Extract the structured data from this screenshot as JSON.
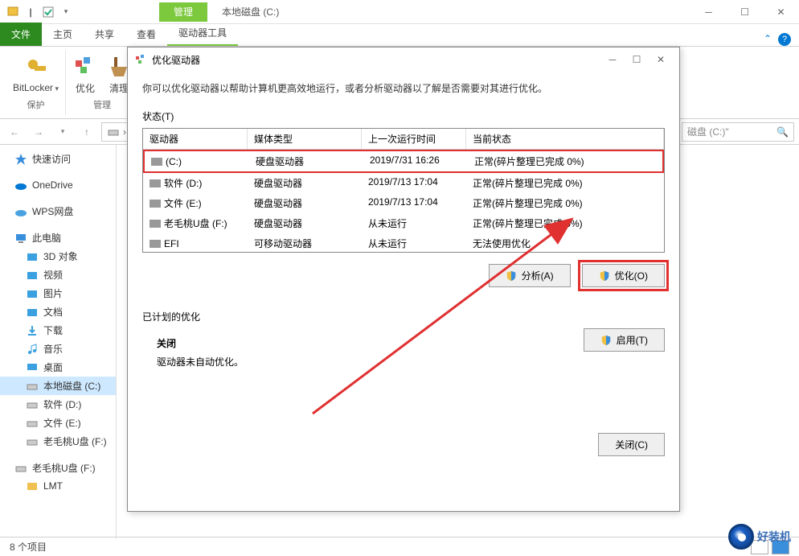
{
  "window": {
    "manage_tab": "管理",
    "title": "本地磁盘 (C:)"
  },
  "ribbon": {
    "file": "文件",
    "tabs": [
      "主页",
      "共享",
      "查看",
      "驱动器工具"
    ],
    "groups": {
      "protect": {
        "bitlocker": "BitLocker",
        "label": "保护"
      },
      "manage": {
        "optimize": "优化",
        "cleanup": "清理",
        "label": "管理"
      }
    }
  },
  "nav": {
    "search_placeholder": "磁盘 (C:)\""
  },
  "sidebar": {
    "quick": "快速访问",
    "onedrive": "OneDrive",
    "wps": "WPS网盘",
    "thispc": "此电脑",
    "items": [
      "3D 对象",
      "视频",
      "图片",
      "文档",
      "下载",
      "音乐",
      "桌面",
      "本地磁盘 (C:)",
      "软件 (D:)",
      "文件 (E:)",
      "老毛桃U盘 (F:)",
      "老毛桃U盘 (F:)",
      "LMT"
    ]
  },
  "status": {
    "items": "8 个项目"
  },
  "dialog": {
    "title": "优化驱动器",
    "desc": "你可以优化驱动器以帮助计算机更高效地运行，或者分析驱动器以了解是否需要对其进行优化。",
    "status_label": "状态(T)",
    "headers": {
      "drive": "驱动器",
      "media": "媒体类型",
      "last": "上一次运行时间",
      "status": "当前状态"
    },
    "rows": [
      {
        "name": "(C:)",
        "media": "硬盘驱动器",
        "last": "2019/7/31 16:26",
        "status": "正常(碎片整理已完成 0%)",
        "hl": true
      },
      {
        "name": "软件 (D:)",
        "media": "硬盘驱动器",
        "last": "2019/7/13 17:04",
        "status": "正常(碎片整理已完成 0%)"
      },
      {
        "name": "文件 (E:)",
        "media": "硬盘驱动器",
        "last": "2019/7/13 17:04",
        "status": "正常(碎片整理已完成 0%)"
      },
      {
        "name": "老毛桃U盘 (F:)",
        "media": "硬盘驱动器",
        "last": "从未运行",
        "status": "正常(碎片整理已完成 0%)"
      },
      {
        "name": "EFI",
        "media": "可移动驱动器",
        "last": "从未运行",
        "status": "无法使用优化"
      }
    ],
    "analyze": "分析(A)",
    "optimize": "优化(O)",
    "scheduled_label": "已计划的优化",
    "scheduled_status": "关闭",
    "scheduled_note": "驱动器未自动优化。",
    "enable": "启用(T)",
    "close": "关闭(C)"
  },
  "watermark": "好装机"
}
